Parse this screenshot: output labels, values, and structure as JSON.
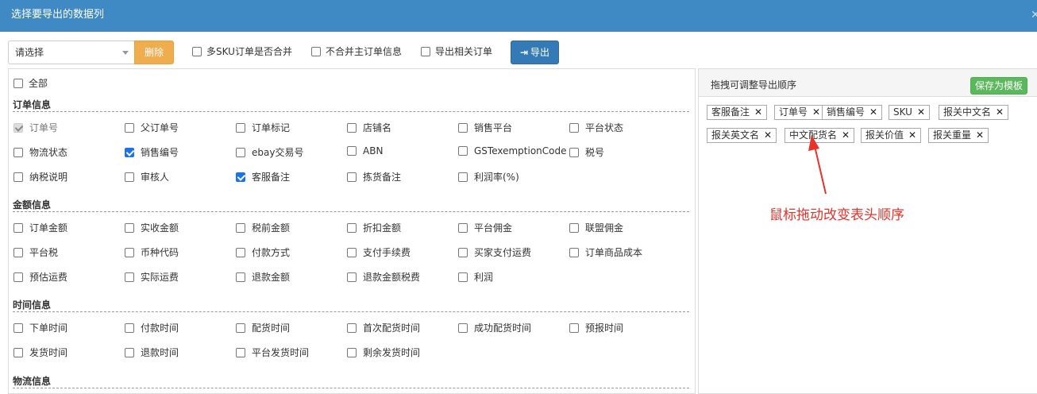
{
  "dialog": {
    "title": "选择要导出的数据列"
  },
  "toolbar": {
    "select_value": "请选择",
    "delete_label": "删除",
    "options": [
      {
        "label": "多SKU订单是否合并",
        "checked": false
      },
      {
        "label": "不合并主订单信息",
        "checked": false
      },
      {
        "label": "导出相关订单",
        "checked": false
      }
    ],
    "export_label": "导出"
  },
  "left": {
    "all_label": "全部",
    "sections": [
      {
        "title": "订单信息",
        "items": [
          {
            "label": "订单号",
            "checked": true,
            "disabled": true
          },
          {
            "label": "父订单号",
            "checked": false
          },
          {
            "label": "订单标记",
            "checked": false
          },
          {
            "label": "店铺名",
            "checked": false
          },
          {
            "label": "销售平台",
            "checked": false
          },
          {
            "label": "平台状态",
            "checked": false
          },
          {
            "label": "物流状态",
            "checked": false
          },
          {
            "label": "销售编号",
            "checked": true
          },
          {
            "label": "ebay交易号",
            "checked": false
          },
          {
            "label": "ABN",
            "checked": false
          },
          {
            "label": "GSTexemptionCode",
            "checked": false
          },
          {
            "label": "税号",
            "checked": false
          },
          {
            "label": "纳税说明",
            "checked": false
          },
          {
            "label": "审核人",
            "checked": false
          },
          {
            "label": "客服备注",
            "checked": true
          },
          {
            "label": "拣货备注",
            "checked": false
          },
          {
            "label": "利润率(%)",
            "checked": false
          }
        ]
      },
      {
        "title": "金额信息",
        "items": [
          {
            "label": "订单金额",
            "checked": false
          },
          {
            "label": "实收金额",
            "checked": false
          },
          {
            "label": "税前金额",
            "checked": false
          },
          {
            "label": "折扣金额",
            "checked": false
          },
          {
            "label": "平台佣金",
            "checked": false
          },
          {
            "label": "联盟佣金",
            "checked": false
          },
          {
            "label": "平台税",
            "checked": false
          },
          {
            "label": "币种代码",
            "checked": false
          },
          {
            "label": "付款方式",
            "checked": false
          },
          {
            "label": "支付手续费",
            "checked": false
          },
          {
            "label": "买家支付运费",
            "checked": false
          },
          {
            "label": "订单商品成本",
            "checked": false
          },
          {
            "label": "预估运费",
            "checked": false
          },
          {
            "label": "实际运费",
            "checked": false
          },
          {
            "label": "退款金额",
            "checked": false
          },
          {
            "label": "退款金额税费",
            "checked": false
          },
          {
            "label": "利润",
            "checked": false
          }
        ]
      },
      {
        "title": "时间信息",
        "items": [
          {
            "label": "下单时间",
            "checked": false
          },
          {
            "label": "付款时间",
            "checked": false
          },
          {
            "label": "配货时间",
            "checked": false
          },
          {
            "label": "首次配货时间",
            "checked": false
          },
          {
            "label": "成功配货时间",
            "checked": false
          },
          {
            "label": "预报时间",
            "checked": false
          },
          {
            "label": "发货时间",
            "checked": false
          },
          {
            "label": "退款时间",
            "checked": false
          },
          {
            "label": "平台发货时间",
            "checked": false
          },
          {
            "label": "剩余发货时间",
            "checked": false
          }
        ]
      },
      {
        "title": "物流信息",
        "items": []
      }
    ]
  },
  "right": {
    "header": "拖拽可调整导出顺序",
    "save_label": "保存为模板",
    "tags": [
      "客服备注",
      "订单号",
      "销售编号",
      "SKU",
      "报关中文名",
      "报关英文名",
      "中文配货名",
      "报关价值",
      "报关重量"
    ]
  },
  "annotation": {
    "text": "鼠标拖动改变表头顺序",
    "color": "#e8322a"
  }
}
